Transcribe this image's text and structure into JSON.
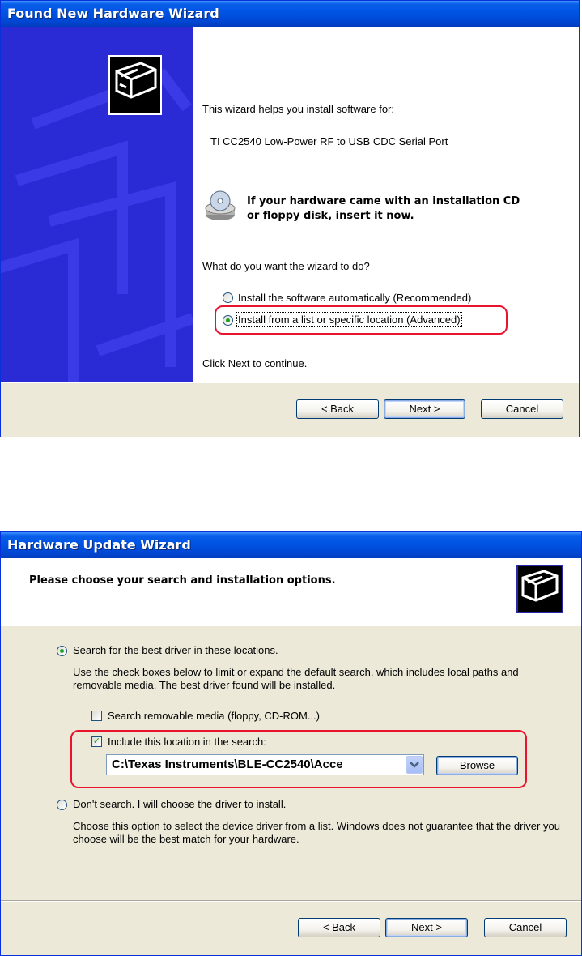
{
  "dialog1": {
    "title": "Found New Hardware Wizard",
    "intro": "This wizard helps you install software for:",
    "device_name": "TI CC2540 Low-Power RF to USB CDC Serial Port",
    "cd_line1": "If your hardware came with an installation CD",
    "cd_line2": "or floppy disk, insert it now.",
    "question": "What do you want the wizard to do?",
    "option_auto": "Install the software automatically (Recommended)",
    "option_advanced": "Install from a list or specific location (Advanced)",
    "selected_option": "advanced",
    "continue_text": "Click Next to continue.",
    "back_label": "< Back",
    "next_label": "Next >",
    "cancel_label": "Cancel"
  },
  "dialog2": {
    "title": "Hardware Update Wizard",
    "heading": "Please choose your search and installation options.",
    "option_search": "Search for the best driver in these locations.",
    "search_desc": "Use the check boxes below to limit or expand the default search, which includes local paths and removable media. The best driver found will be installed.",
    "check_removable": "Search removable media (floppy, CD-ROM...)",
    "check_removable_checked": false,
    "check_location": "Include this location in the search:",
    "check_location_checked": true,
    "location_value": "C:\\Texas Instruments\\BLE-CC2540\\Acce",
    "browse_label": "Browse",
    "option_dont_search": "Don't search. I will choose the driver to install.",
    "dont_search_desc": "Choose this option to select the device driver from a list.  Windows does not guarantee that the driver you choose will be the best match for your hardware.",
    "selected_option": "search",
    "back_label": "< Back",
    "next_label": "Next >",
    "cancel_label": "Cancel"
  },
  "colors": {
    "highlight_outline": "#e8142e",
    "titlebar_blue": "#0055e5",
    "sidebar_blue": "#2b2bd6",
    "dialog_face": "#ece9d8"
  }
}
